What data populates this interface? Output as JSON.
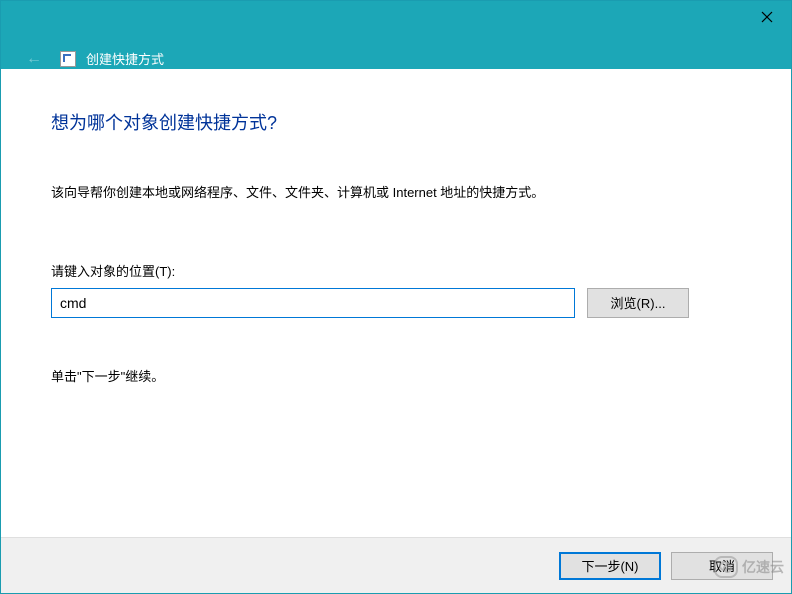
{
  "titlebar": {
    "title": "创建快捷方式"
  },
  "content": {
    "heading": "想为哪个对象创建快捷方式?",
    "description": "该向导帮你创建本地或网络程序、文件、文件夹、计算机或 Internet 地址的快捷方式。",
    "location_label": "请键入对象的位置(T):",
    "location_value": "cmd",
    "browse_label": "浏览(R)...",
    "hint": "单击\"下一步\"继续。"
  },
  "footer": {
    "next_label": "下一步(N)",
    "cancel_label": "取消"
  },
  "watermark": {
    "text": "亿速云"
  }
}
